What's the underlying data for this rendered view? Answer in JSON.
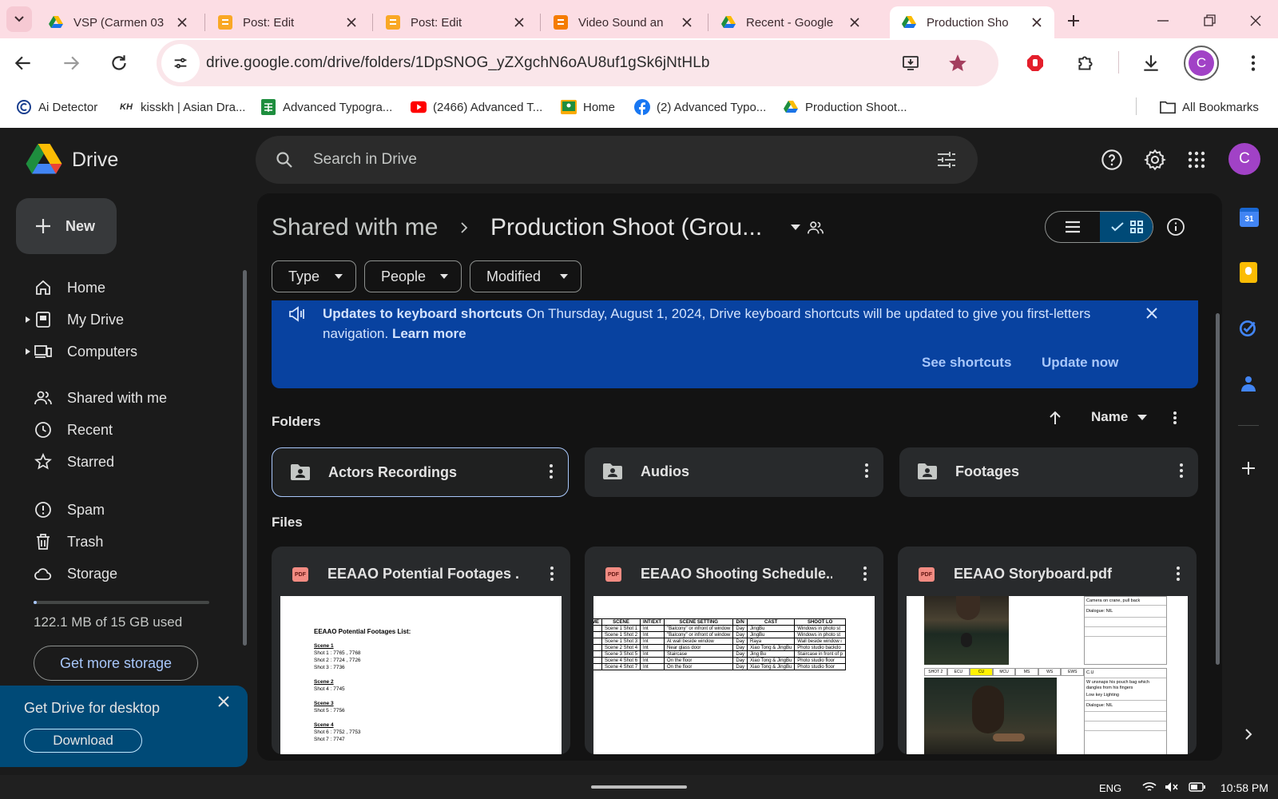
{
  "browser": {
    "tabs": [
      {
        "title": "VSP (Carmen 03"
      },
      {
        "title": "Post: Edit"
      },
      {
        "title": "Post: Edit"
      },
      {
        "title": "Video Sound an"
      },
      {
        "title": "Recent - Google"
      },
      {
        "title": "Production Sho"
      }
    ],
    "url": "drive.google.com/drive/folders/1DpSNOG_yZXgchN6oAU8uf1gSk6jNtHLb",
    "profile_initial": "C",
    "bookmarks": [
      {
        "label": "Ai Detector"
      },
      {
        "label": "kisskh | Asian Dra..."
      },
      {
        "label": "Advanced Typogra..."
      },
      {
        "label": "(2466) Advanced T..."
      },
      {
        "label": "Home"
      },
      {
        "label": "(2) Advanced Typo..."
      },
      {
        "label": "Production Shoot..."
      }
    ],
    "all_bookmarks": "All Bookmarks"
  },
  "drive": {
    "logo_text": "Drive",
    "search_placeholder": "Search in Drive",
    "avatar_initial": "C",
    "new_label": "New",
    "nav": [
      {
        "label": "Home",
        "icon": "home-icon"
      },
      {
        "label": "My Drive",
        "icon": "my-drive-icon"
      },
      {
        "label": "Computers",
        "icon": "computers-icon"
      },
      {
        "label": "Shared with me",
        "icon": "shared-icon"
      },
      {
        "label": "Recent",
        "icon": "clock-icon"
      },
      {
        "label": "Starred",
        "icon": "star-icon"
      },
      {
        "label": "Spam",
        "icon": "spam-icon"
      },
      {
        "label": "Trash",
        "icon": "trash-icon"
      },
      {
        "label": "Storage",
        "icon": "cloud-icon"
      }
    ],
    "storage_used_fraction": 0.008,
    "storage_text": "122.1 MB of 15 GB used",
    "get_storage": "Get more storage",
    "desktop_promo": {
      "title": "Get Drive for desktop",
      "button": "Download"
    },
    "breadcrumb": {
      "parent": "Shared with me",
      "current": "Production Shoot (Grou..."
    },
    "filters": [
      "Type",
      "People",
      "Modified"
    ],
    "banner": {
      "title": "Updates to keyboard shortcuts",
      "text": " On Thursday, August 1, 2024, Drive keyboard shortcuts will be updated to give you first-letters navigation.",
      "learn_more": "Learn more",
      "see_shortcuts": "See shortcuts",
      "update_now": "Update now"
    },
    "folders_heading": "Folders",
    "sort_label": "Name",
    "folders": [
      {
        "name": "Actors Recordings"
      },
      {
        "name": "Audios"
      },
      {
        "name": "Footages"
      }
    ],
    "files_heading": "Files",
    "files": [
      {
        "name": "EEAAO Potential Footages ..."
      },
      {
        "name": "EEAAO Shooting Schedule...."
      },
      {
        "name": "EEAAO Storyboard.pdf"
      }
    ],
    "thumb_footages": {
      "title": "EEAAO Potential Footages List:",
      "lines": [
        "Scene 1",
        "Shot 1 : 7765 , 7768",
        "Shot 2 : 7724 , 7726",
        "Shot 3 : 7736",
        "",
        "Scene 2",
        "Shot 4 : 7745",
        "",
        "Scene 3",
        "Shot 5 : 7756",
        "",
        "Scene 4",
        "Shot 6 : 7752 , 7753",
        "Shot 7 : 7747"
      ]
    },
    "thumb_schedule": {
      "headers": [
        "ME",
        "SCENE",
        "INT/EXT",
        "SCENE SETTING",
        "D/N",
        "CAST",
        "SHOOT LO"
      ],
      "rows": [
        [
          "",
          "Scene 1 Shot 1",
          "Int",
          "\"Balcony\" or infront of window",
          "Day",
          "JingBu",
          "Windows in photo st"
        ],
        [
          "",
          "Scene 1 Shot 2",
          "Int",
          "\"Balcony\" or infront of window",
          "Day",
          "JingBu",
          "Windows in photo st"
        ],
        [
          "",
          "Scene 1 Shot 3",
          "Int",
          "At wall beside window",
          "Day",
          "Raya",
          "Wall beside window i"
        ],
        [
          "",
          "Scene 2 Shot 4",
          "Int",
          "Near glass door",
          "Day",
          "Xiao Tong & JingBu",
          "Photo studio backdo"
        ],
        [
          "",
          "Scene 3 Shot 5",
          "Int",
          "Staircase",
          "Day",
          "Jing Bu",
          "Staircase in front of p"
        ],
        [
          "",
          "Scene 4 Shot 6",
          "Int",
          "On the floor",
          "Day",
          "Xiao Tong & JingBu",
          "Photo studio floor"
        ],
        [
          "",
          "Scene 4 Shot 7",
          "Int",
          "On the floor",
          "Day",
          "Xiao Tong & JingBu",
          "Photo studio floor"
        ]
      ]
    },
    "thumb_storyboard": {
      "note1": "Camera on crane, pull back",
      "dialogue1": "Dialogue: NIL",
      "shot_labels": [
        "SHOT 2",
        "ECU",
        "CU",
        "MCU",
        "MS",
        "WS",
        "EWS"
      ],
      "note2": "C.U",
      "note3": "W unsnaps his pouch bag which dangles from his fingers",
      "note4": "Low key Lighting",
      "dialogue2": "Dialogue: NIL"
    }
  },
  "taskbar": {
    "lang": "ENG",
    "time": "10:58 PM"
  },
  "colors": {
    "accent": "#0842a0",
    "brand_purple": "#a142c6",
    "bg": "#1b1b1b"
  }
}
